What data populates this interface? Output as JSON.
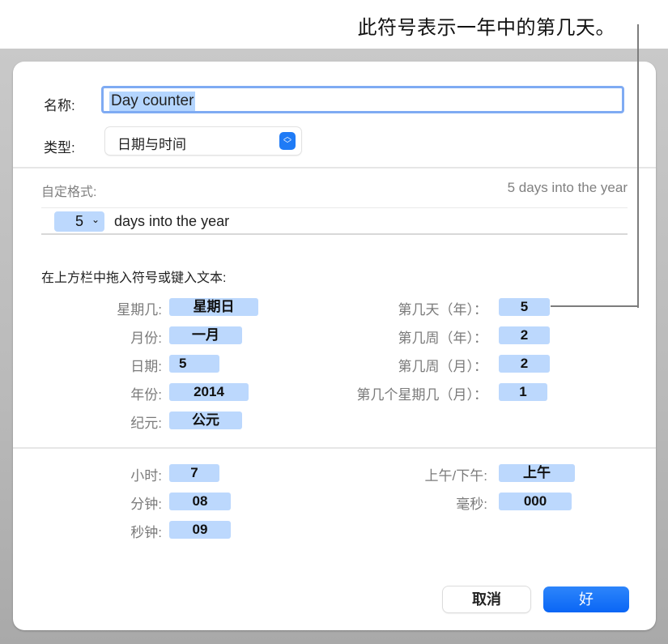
{
  "callout": {
    "text": "此符号表示一年中的第几天。"
  },
  "dialog": {
    "name_label": "名称:",
    "name_value": "Day counter",
    "type_label": "类型:",
    "type_value": "日期与时间",
    "custom_format_label": "自定格式:",
    "preview": "5 days into the year",
    "format_bar": {
      "token_value": "5",
      "token_chevron": "⌄",
      "suffix_text": "days into the year"
    },
    "drag_hint": "在上方栏中拖入符号或键入文本:",
    "date_tokens_left": [
      {
        "label": "星期几:",
        "value": "星期日"
      },
      {
        "label": "月份:",
        "value": "一月"
      },
      {
        "label": "日期:",
        "value": "5"
      },
      {
        "label": "年份:",
        "value": "2014"
      },
      {
        "label": "纪元:",
        "value": "公元"
      }
    ],
    "date_tokens_right": [
      {
        "label": "第几天（年）：",
        "value": "5"
      },
      {
        "label": "第几周（年）：",
        "value": "2"
      },
      {
        "label": "第几周（月）：",
        "value": "2"
      },
      {
        "label": "第几个星期几（月）：",
        "value": "1"
      }
    ],
    "time_tokens_left": [
      {
        "label": "小时:",
        "value": "7"
      },
      {
        "label": "分钟:",
        "value": "08"
      },
      {
        "label": "秒钟:",
        "value": "09"
      }
    ],
    "time_tokens_right": [
      {
        "label": "上午/下午:",
        "value": "上午"
      },
      {
        "label": "毫秒:",
        "value": "000"
      }
    ],
    "buttons": {
      "cancel": "取消",
      "ok": "好"
    }
  }
}
